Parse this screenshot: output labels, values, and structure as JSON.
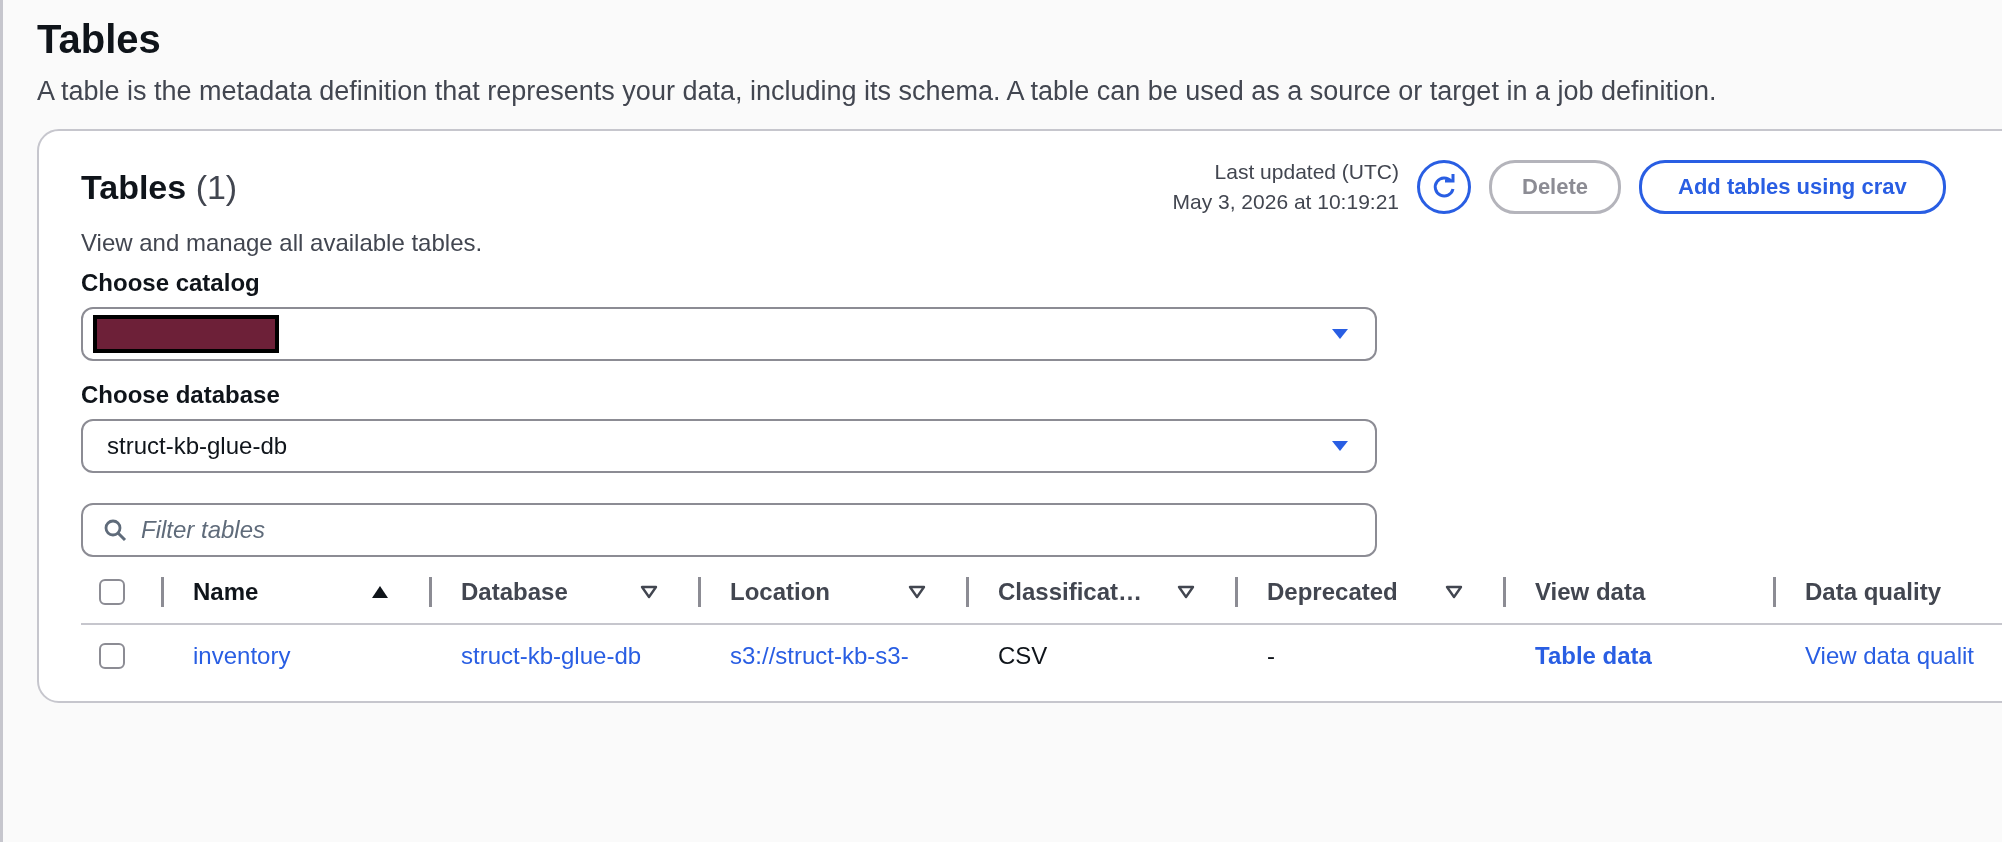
{
  "page": {
    "title": "Tables",
    "description": "A table is the metadata definition that represents your data, including its schema. A table can be used as a source or target in a job definition."
  },
  "panel": {
    "title": "Tables",
    "count": "(1)",
    "subtitle": "View and manage all available tables.",
    "last_updated_label": "Last updated (UTC)",
    "last_updated_value": "May 3, 2026 at 10:19:21",
    "buttons": [
      {
        "label": "Delete",
        "kind": "secondary",
        "disabled": true
      },
      {
        "label": "Add tables using crav",
        "kind": "primary",
        "disabled": false
      }
    ]
  },
  "catalog": {
    "label": "Choose catalog",
    "value_redacted": true
  },
  "database": {
    "label": "Choose database",
    "value": "struct-kb-glue-db"
  },
  "filter": {
    "placeholder": "Filter tables"
  },
  "table": {
    "all_selected": false,
    "columns": [
      {
        "label": "Name",
        "sorted": true
      },
      {
        "label": "Database",
        "sorted": false
      },
      {
        "label": "Location",
        "sorted": false
      },
      {
        "label": "Classificat…",
        "sorted": false
      },
      {
        "label": "Deprecated",
        "sorted": false
      },
      {
        "label": "View data"
      },
      {
        "label": "Data quality"
      }
    ],
    "rows": [
      {
        "selected": false,
        "cells": [
          {
            "text": "inventory",
            "kind": "link"
          },
          {
            "text": "struct-kb-glue-db",
            "kind": "link"
          },
          {
            "text": "s3://struct-kb-s3-",
            "kind": "link"
          },
          {
            "text": "CSV",
            "kind": "text"
          },
          {
            "text": "-",
            "kind": "text"
          },
          {
            "text": "Table data",
            "kind": "strong-link"
          },
          {
            "text": "View data qualit",
            "kind": "link"
          }
        ]
      }
    ]
  }
}
